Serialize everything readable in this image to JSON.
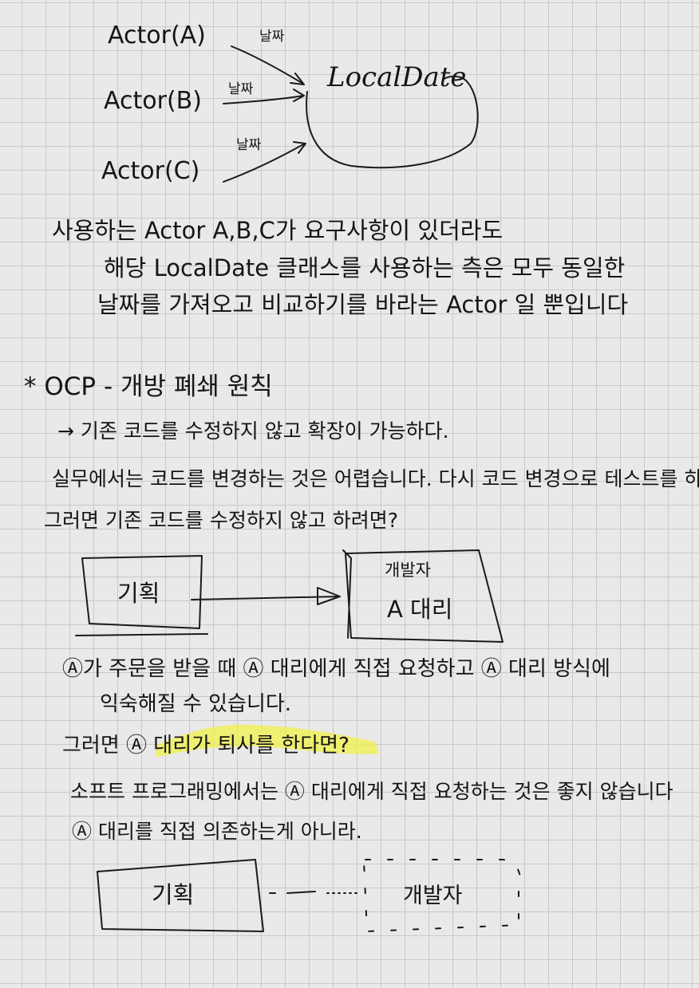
{
  "diagram1": {
    "actors": [
      "Actor(A)",
      "Actor(B)",
      "Actor(C)"
    ],
    "edge_labels": [
      "날짜",
      "날짜",
      "날짜"
    ],
    "target": "LocalDate"
  },
  "paragraph1": [
    "사용하는 Actor A,B,C가 요구사항이 있더라도",
    "해당 LocalDate 클래스를 사용하는 측은 모두 동일한",
    "날짜를 가져오고 비교하기를 바라는 Actor 일 뿐입니다"
  ],
  "ocp": {
    "heading": "* OCP - 개방 폐쇄 원칙",
    "definition": "→ 기존 코드를 수정하지 않고 확장이 가능하다.",
    "line1": "실무에서는 코드를 변경하는 것은 어렵습니다. 다시 코드 변경으로 테스트를 하고..",
    "question": "그러면 기존 코드를 수정하지 않고 하려면?"
  },
  "diagram2": {
    "left_box": "기획",
    "right_box_top": "개발자",
    "right_box_bottom": "A 대리"
  },
  "paragraph2": {
    "line1": "Ⓐ가 주문을 받을 때 Ⓐ 대리에게 직접 요청하고 Ⓐ 대리 방식에",
    "line2": "익숙해질 수 있습니다.",
    "question": "그러면 Ⓐ 대리가 퇴사를 한다면?",
    "line3": "소프트 프로그래밍에서는 Ⓐ 대리에게 직접 요청하는 것은 좋지 않습니다",
    "line4": "Ⓐ 대리를 직접 의존하는게 아니라."
  },
  "diagram3": {
    "left_box": "기획",
    "right_box": "개발자"
  },
  "colors": {
    "ink": "#1a1a1a",
    "highlight": "#f0f04a",
    "paper": "#e9e9e9",
    "grid": "#c9c9c9"
  }
}
